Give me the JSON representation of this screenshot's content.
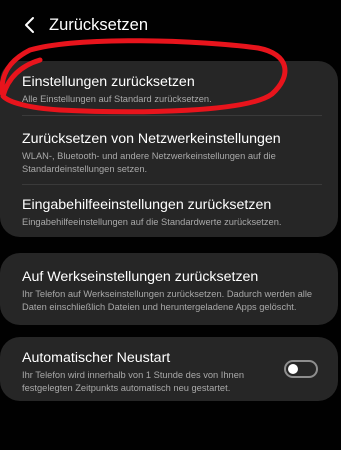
{
  "header": {
    "back_icon": "chevron-left-icon",
    "title": "Zurücksetzen"
  },
  "groups": [
    {
      "items": [
        {
          "title": "Einstellungen zurücksetzen",
          "desc": "Alle Einstellungen auf Standard zurücksetzen."
        },
        {
          "title": "Zurücksetzen von Netzwerkeinstellungen",
          "desc": "WLAN-, Bluetooth- und andere Netzwerkeinstellungen auf die Standardeinstellungen setzen."
        },
        {
          "title": "Eingabehilfeeinstellungen zurücksetzen",
          "desc": "Eingabehilfeeinstellungen auf die Standardwerte zurücksetzen."
        }
      ]
    },
    {
      "items": [
        {
          "title": "Auf Werkseinstellungen zurücksetzen",
          "desc": "Ihr Telefon auf Werkseinstellungen zurücksetzen. Dadurch werden alle Daten einschließlich Dateien und heruntergeladene Apps gelöscht."
        }
      ]
    },
    {
      "items": [
        {
          "title": "Automatischer Neustart",
          "desc": "Ihr Telefon wird innerhalb von 1 Stunde des von Ihnen festgelegten Zeitpunkts automatisch neu gestartet.",
          "toggle_on": false
        }
      ]
    }
  ],
  "colors": {
    "background": "#010101",
    "card": "#262626",
    "annotation": "#e8141c"
  }
}
